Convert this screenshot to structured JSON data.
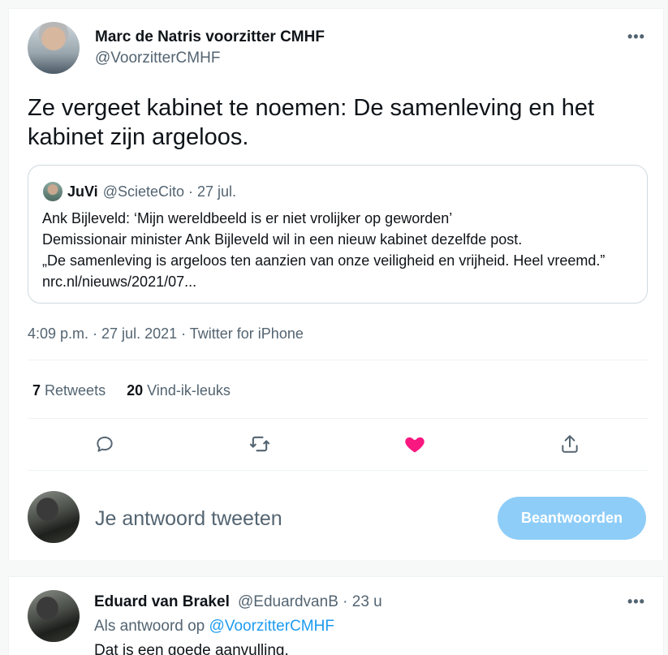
{
  "tweet": {
    "author_name": "Marc de Natris voorzitter CMHF",
    "author_handle": "@VoorzitterCMHF",
    "more_icon": "more-icon",
    "text": "Ze vergeet kabinet te noemen: De samenleving en het kabinet zijn argeloos.",
    "timestamp": "4:09 p.m. · 27 jul. 2021 · Twitter for iPhone",
    "retweets_count": "7",
    "retweets_label": "Retweets",
    "likes_count": "20",
    "likes_label": "Vind-ik-leuks"
  },
  "quote": {
    "author_name": "JuVi",
    "meta": "@ScieteCito · 27 jul.",
    "line1": "Ank Bijleveld: ‘Mijn wereldbeeld is er niet vrolijker op geworden’",
    "line2": "Demissionair minister Ank Bijleveld wil in een nieuw kabinet dezelfde post.",
    "line3": "„De samenleving is argeloos ten aanzien van onze veiligheid en vrijheid. Heel vreemd.” nrc.nl/nieuws/2021/07..."
  },
  "actions": {
    "reply": "reply-icon",
    "retweet": "retweet-icon",
    "like": "heart-icon",
    "share": "share-icon",
    "like_color": "#f91880",
    "icon_color": "#536471"
  },
  "composer": {
    "placeholder": "Je antwoord tweeten",
    "button_label": "Beantwoorden",
    "button_color": "#8ecdf8"
  },
  "reply_tweet": {
    "author_name": "Eduard van Brakel",
    "meta": "@EduardvanB · 23 u",
    "reply_prefix": "Als antwoord op",
    "reply_mention": "@VoorzitterCMHF",
    "text": "Dat is een goede aanvulling."
  }
}
